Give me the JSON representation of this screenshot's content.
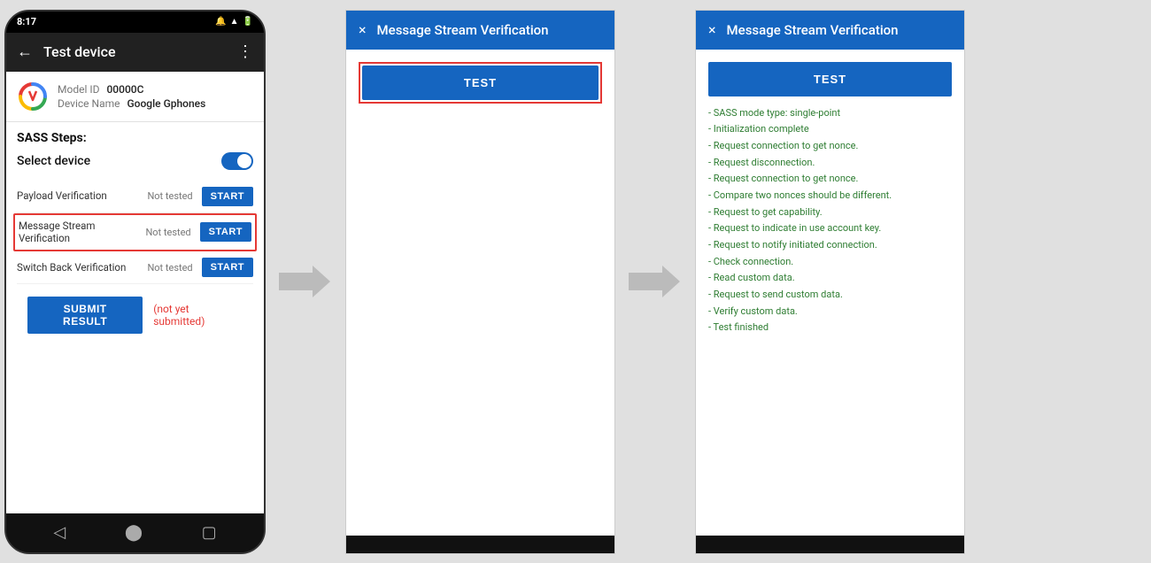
{
  "phone": {
    "status_bar": {
      "time": "8:17",
      "icons": "WiFi Battery"
    },
    "header": {
      "title": "Test device",
      "back_label": "←",
      "more_label": "⋮"
    },
    "device": {
      "model_id_label": "Model ID",
      "model_id_value": "00000C",
      "device_name_label": "Device Name",
      "device_name_value": "Google Gphones"
    },
    "sass": {
      "title": "SASS Steps:",
      "select_device_label": "Select device"
    },
    "steps": [
      {
        "label": "Payload Verification",
        "status": "Not tested",
        "btn_label": "START"
      },
      {
        "label": "Message Stream Verification",
        "status": "Not tested",
        "btn_label": "START",
        "highlighted": true
      },
      {
        "label": "Switch Back Verification",
        "status": "Not tested",
        "btn_label": "START"
      }
    ],
    "submit": {
      "btn_label": "SUBMIT RESULT",
      "status_label": "(not yet submitted)"
    }
  },
  "dialog1": {
    "title": "Message Stream Verification",
    "close_icon": "×",
    "test_btn_label": "TEST"
  },
  "dialog2": {
    "title": "Message Stream Verification",
    "close_icon": "×",
    "test_btn_label": "TEST",
    "log_lines": [
      "- SASS mode type: single-point",
      "- Initialization complete",
      "- Request connection to get nonce.",
      "- Request disconnection.",
      "- Request connection to get nonce.",
      "- Compare two nonces should be different.",
      "- Request to get capability.",
      "- Request to indicate in use account key.",
      "- Request to notify initiated connection.",
      "- Check connection.",
      "- Read custom data.",
      "- Request to send custom data.",
      "- Verify custom data.",
      "- Test finished"
    ]
  }
}
